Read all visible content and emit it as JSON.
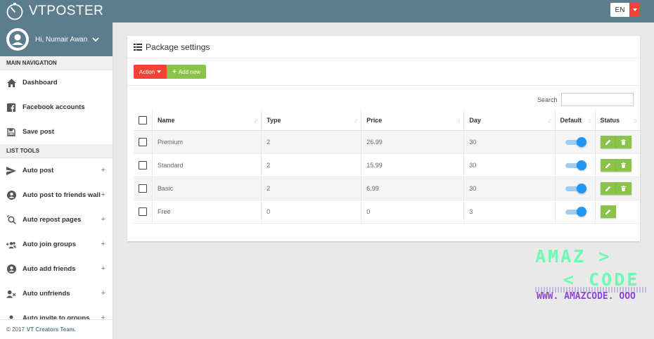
{
  "app": {
    "name": "VTPOSTER",
    "language": "EN"
  },
  "colors": {
    "topbar": "#5b7d8d",
    "danger": "#f44336",
    "success": "#8bc34a",
    "toggle": "#2196f3"
  },
  "user": {
    "greeting": "Hi, Numair Awan"
  },
  "sidebar": {
    "main_heading": "MAIN NAVIGATION",
    "main_items": [
      {
        "label": "Dashboard",
        "icon": "home-icon"
      },
      {
        "label": "Facebook accounts",
        "icon": "facebook-icon"
      },
      {
        "label": "Save post",
        "icon": "save-icon"
      }
    ],
    "tools_heading": "LIST TOOLS",
    "tool_items": [
      {
        "label": "Auto post",
        "icon": "send-icon"
      },
      {
        "label": "Auto post to friends wall",
        "icon": "account-circle-icon"
      },
      {
        "label": "Auto repost pages",
        "icon": "search-repost-icon"
      },
      {
        "label": "Auto join groups",
        "icon": "group-add-icon"
      },
      {
        "label": "Auto add friends",
        "icon": "account-circle-icon"
      },
      {
        "label": "Auto unfriends",
        "icon": "remove-user-icon"
      },
      {
        "label": "Auto invite to groups",
        "icon": "invite-icon"
      }
    ],
    "expand_symbol": "+",
    "footer_prefix": "© 2017",
    "footer_team": "VT Creators Team."
  },
  "card": {
    "title": "Package settings",
    "action_label": "Action",
    "add_label": "Add new",
    "search_label": "Search",
    "search_value": ""
  },
  "table": {
    "columns": [
      "Name",
      "Type",
      "Price",
      "Day",
      "Default",
      "Status"
    ],
    "sort_glyph": "↓↑",
    "rows": [
      {
        "name": "Premium",
        "type": "2",
        "price": "26.99",
        "day": "30",
        "default": true,
        "deletable": true
      },
      {
        "name": "Standard",
        "type": "2",
        "price": "15.99",
        "day": "30",
        "default": true,
        "deletable": true
      },
      {
        "name": "Basic",
        "type": "2",
        "price": "6.99",
        "day": "30",
        "default": true,
        "deletable": true
      },
      {
        "name": "Free",
        "type": "0",
        "price": "0",
        "day": "3",
        "default": true,
        "deletable": false
      }
    ]
  },
  "watermark": {
    "line1": "AMAZ >",
    "line2": "< CODE",
    "line3": "WWW. AMAZCODE. OOO"
  }
}
